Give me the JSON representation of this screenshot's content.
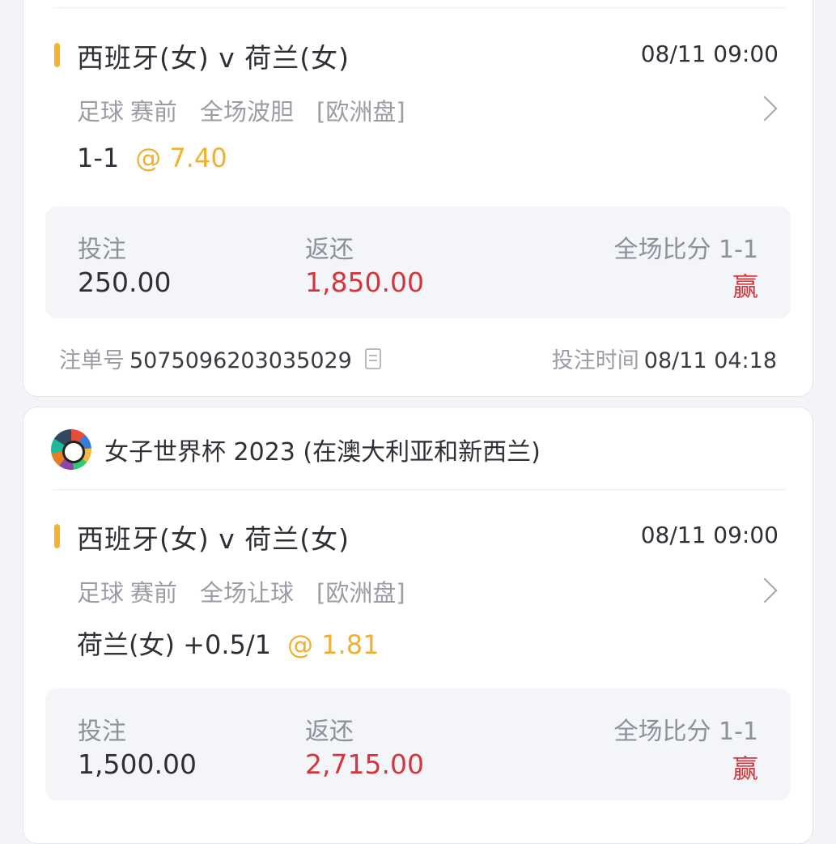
{
  "bets": [
    {
      "match": "西班牙(女) v 荷兰(女)",
      "match_time": "08/11 09:00",
      "sport": "足球",
      "stage": "赛前",
      "market": "全场波胆",
      "odds_type": "[欧洲盘]",
      "selection": "1-1",
      "odds": "@ 7.40",
      "stake_label": "投注",
      "stake": "250.00",
      "return_label": "返还",
      "return": "1,850.00",
      "score_label": "全场比分 1-1",
      "result": "赢",
      "ticket_label": "注单号",
      "ticket_no": "5075096203035029",
      "bet_time_label": "投注时间",
      "bet_time": "08/11 04:18"
    },
    {
      "league": "女子世界杯 2023 (在澳大利亚和新西兰)",
      "match": "西班牙(女) v 荷兰(女)",
      "match_time": "08/11 09:00",
      "sport": "足球",
      "stage": "赛前",
      "market": "全场让球",
      "odds_type": "[欧洲盘]",
      "selection": "荷兰(女) +0.5/1",
      "odds": "@ 1.81",
      "stake_label": "投注",
      "stake": "1,500.00",
      "return_label": "返还",
      "return": "2,715.00",
      "score_label": "全场比分 1-1",
      "result": "赢"
    }
  ],
  "colors": {
    "accent": "#f5b42c",
    "odds": "#f0b030",
    "win": "#d4363b"
  },
  "icons": {
    "chevron": "chevron-right-icon",
    "copy": "copy-icon",
    "league": "league-logo-icon"
  }
}
